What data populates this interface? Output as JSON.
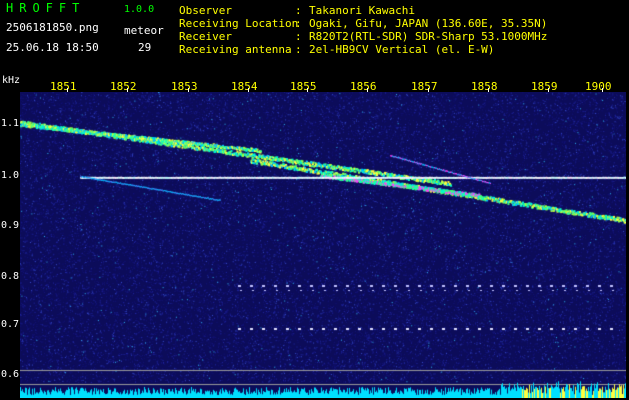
{
  "header": {
    "app_name": "HROFFT",
    "app_version": "1.0.0",
    "file_name": "2506181850.png",
    "timestamp": "25.06.18 18:50",
    "meteor_label": "meteor",
    "meteor_count": "29"
  },
  "info": [
    {
      "label": "Observer",
      "value": "Takanori Kawachi"
    },
    {
      "label": "Receiving Location",
      "value": "Ogaki, Gifu, JAPAN (136.60E, 35.35N)"
    },
    {
      "label": "Receiver",
      "value": "R820T2(RTL-SDR) SDR-Sharp 53.1000MHz"
    },
    {
      "label": "Receiving antenna",
      "value": "2el-HB9CV Vertical (el. E-W)"
    }
  ],
  "axis": {
    "freq_unit": "kHz",
    "time_ticks": [
      "1851",
      "1852",
      "1853",
      "1854",
      "1855",
      "1856",
      "1857",
      "1858",
      "1859",
      "1900"
    ],
    "freq_ticks": [
      "1.1",
      "1.0",
      "0.9",
      "0.8",
      "0.7",
      "0.6"
    ]
  },
  "colors": {
    "header_green": "#00ff00",
    "info_yellow": "#ffff00",
    "background_noise": "#1a1a8c",
    "signal_cyan": "#00e0ff",
    "signal_peak": "#ff40ff"
  }
}
